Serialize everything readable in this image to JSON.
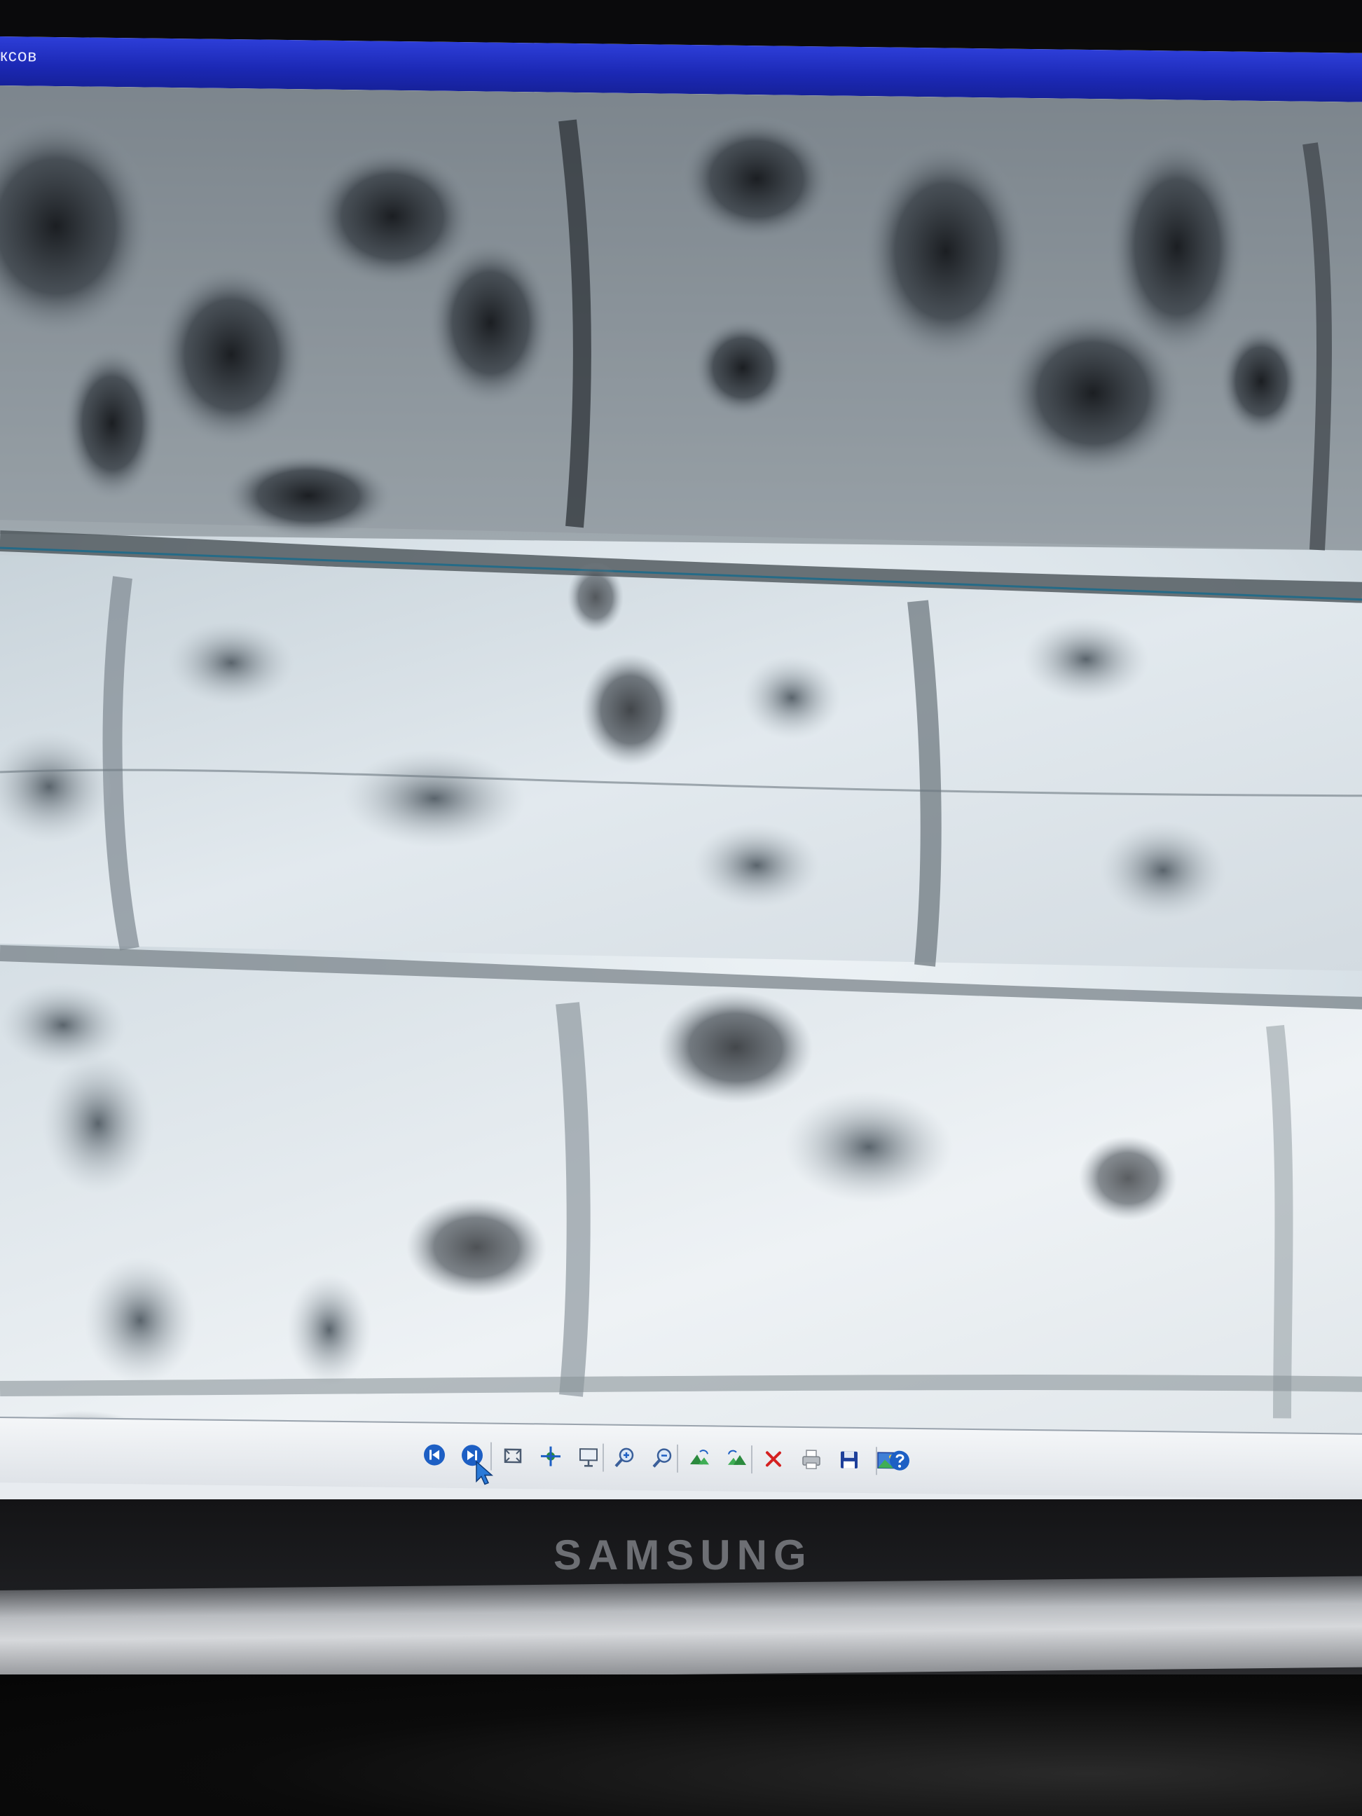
{
  "window": {
    "title": "ксов"
  },
  "image_viewer": {
    "image_subject": "stone-wall-photo"
  },
  "toolbar": {
    "buttons": [
      {
        "name": "previous-image-button",
        "icon": "skip-back-icon"
      },
      {
        "name": "next-image-button",
        "icon": "skip-forward-icon"
      },
      {
        "name": "best-fit-button",
        "icon": "fit-window-icon"
      },
      {
        "name": "actual-size-button",
        "icon": "actual-size-icon"
      },
      {
        "name": "slideshow-button",
        "icon": "slideshow-icon"
      },
      {
        "name": "zoom-in-button",
        "icon": "zoom-in-icon"
      },
      {
        "name": "zoom-out-button",
        "icon": "zoom-out-icon"
      },
      {
        "name": "rotate-clockwise-button",
        "icon": "rotate-cw-icon"
      },
      {
        "name": "rotate-counterclockwise-button",
        "icon": "rotate-ccw-icon"
      },
      {
        "name": "delete-button",
        "icon": "delete-x-icon"
      },
      {
        "name": "print-button",
        "icon": "printer-icon"
      },
      {
        "name": "save-button",
        "icon": "floppy-disk-icon"
      },
      {
        "name": "open-in-editor-button",
        "icon": "edit-picture-icon"
      },
      {
        "name": "help-button",
        "icon": "help-icon"
      }
    ],
    "accent_color": "#1d5fc4",
    "delete_color": "#d42020"
  },
  "monitor": {
    "brand": "SAMSUNG"
  }
}
